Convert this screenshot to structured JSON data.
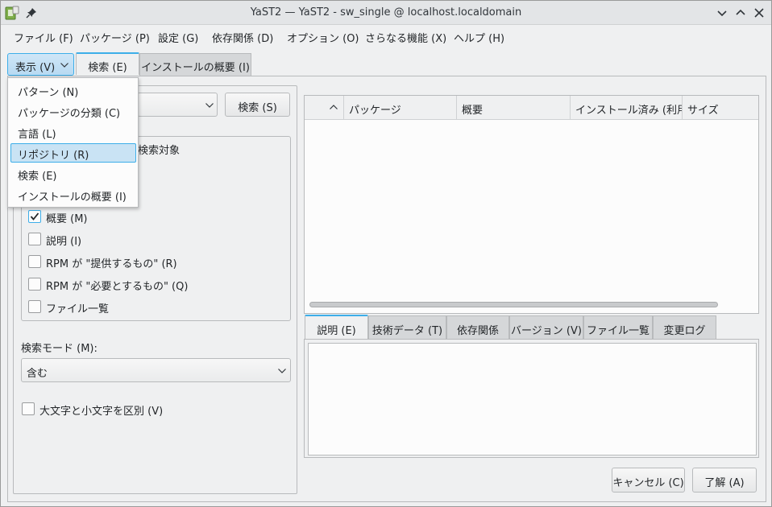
{
  "titlebar": {
    "title": "YaST2 — YaST2 - sw_single @ localhost.localdomain"
  },
  "menubar": {
    "items": [
      {
        "label": "ファイル (F)"
      },
      {
        "label": "パッケージ (P)"
      },
      {
        "label": "設定 (G)"
      },
      {
        "label": "依存関係 (D)"
      },
      {
        "label": "オプション (O)"
      },
      {
        "label": "さらなる機能 (X)"
      },
      {
        "label": "ヘルプ (H)"
      }
    ]
  },
  "toolbar": {
    "view_label": "表示 (V)",
    "tabs": [
      {
        "label": "検索 (E)"
      },
      {
        "label": "インストールの概要 (I)"
      }
    ]
  },
  "view_menu": {
    "items": [
      {
        "label": "パターン (N)"
      },
      {
        "label": "パッケージの分類 (C)"
      },
      {
        "label": "言語 (L)"
      },
      {
        "label": "リポジトリ (R)"
      },
      {
        "label": "検索 (E)"
      },
      {
        "label": "インストールの概要 (I)"
      }
    ],
    "selected_index": 3
  },
  "search": {
    "search_button": "検索 (S)",
    "group_title": "検索対象",
    "criteria": [
      {
        "label": "概要 (M)",
        "checked": true
      },
      {
        "label": "説明 (I)",
        "checked": false
      },
      {
        "label": "RPM が \"提供するもの\" (R)",
        "checked": false
      },
      {
        "label": "RPM が \"必要とするもの\" (Q)",
        "checked": false
      },
      {
        "label": "ファイル一覧",
        "checked": false
      }
    ],
    "mode_label": "検索モード (M):",
    "mode_value": "含む",
    "case_label": "大文字と小文字を区別 (V)",
    "case_checked": false
  },
  "package_table": {
    "columns": [
      {
        "label": ""
      },
      {
        "label": "パッケージ"
      },
      {
        "label": "概要"
      },
      {
        "label": "インストール済み (利用可能)"
      },
      {
        "label": "サイズ"
      }
    ]
  },
  "detail_tabs": [
    {
      "label": "説明 (E)"
    },
    {
      "label": "技術データ (T)"
    },
    {
      "label": "依存関係"
    },
    {
      "label": "バージョン (V)"
    },
    {
      "label": "ファイル一覧"
    },
    {
      "label": "変更ログ"
    }
  ],
  "footer": {
    "cancel_label": "キャンセル (C)",
    "ok_label": "了解 (A)"
  },
  "colors": {
    "accent": "#3daee9",
    "window_bg": "#eff0f1",
    "selection_bg": "#c9e3f4"
  }
}
